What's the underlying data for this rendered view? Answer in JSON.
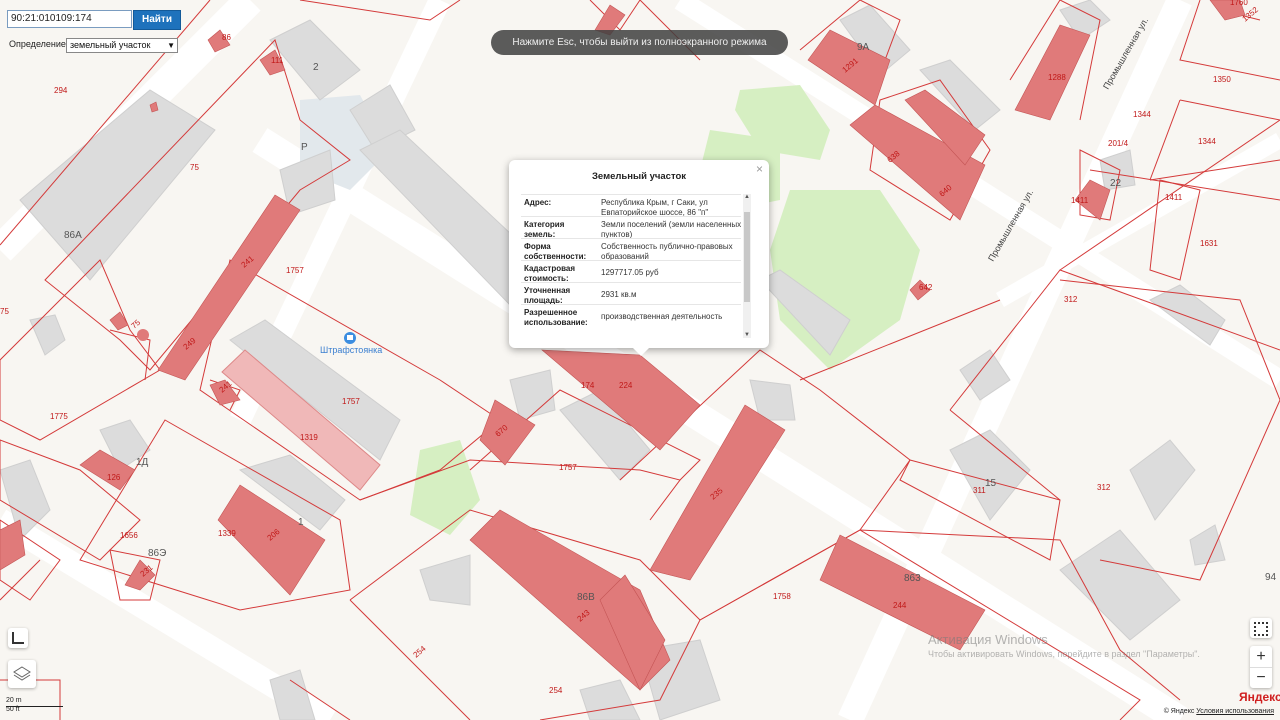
{
  "search": {
    "value": "90:21:010109:174",
    "button_label": "Найти"
  },
  "definition": {
    "label": "Определение:",
    "selected": "земельный участок"
  },
  "fullscreen_notice": "Нажмите Esc, чтобы выйти из полноэкранного режима",
  "popup": {
    "title": "Земельный участок",
    "rows": [
      {
        "key": "Адрес:",
        "value": "Республика Крым, г Саки, ул Евпаторийское шоссе, 86 \"п\""
      },
      {
        "key": "Категория земель:",
        "value": "Земли поселений (земли населенных пунктов)"
      },
      {
        "key": "Форма собственности:",
        "value": "Собственность публично-правовых образований"
      },
      {
        "key": "Кадастровая стоимость:",
        "value": "1297717.05 руб"
      },
      {
        "key": "Уточненная площадь:",
        "value": "2931 кв.м"
      },
      {
        "key": "Разрешенное использование:",
        "value": "производственная деятельность"
      }
    ]
  },
  "map": {
    "poi_parking": "Штрафстоянка",
    "streets": [
      "Промышленная ул.",
      "Промышленная ул."
    ],
    "parcel_labels": [
      "294",
      "75",
      "86",
      "1757",
      "241",
      "249",
      "241",
      "1757",
      "1319",
      "1775",
      "126",
      "1656",
      "231",
      "1339",
      "206",
      "670",
      "174",
      "224",
      "1757",
      "235",
      "1758",
      "863",
      "244",
      "243",
      "254",
      "254",
      "312",
      "311",
      "312",
      "1631",
      "1411",
      "1411",
      "1350",
      "1344",
      "1344",
      "201/4",
      "1288",
      "1291",
      "638",
      "640",
      "1352",
      "1760",
      "642",
      "75",
      "75",
      "111"
    ],
    "building_labels": [
      "2",
      "86А",
      "9А",
      "22",
      "15",
      "1Д",
      "86Э",
      "1",
      "86В",
      "94",
      "Р"
    ]
  },
  "controls": {
    "layers_icon": "layers-icon",
    "ruler_icon": "ruler-icon",
    "fullscreen_icon": "fullscreen-icon",
    "zoom_in": "+",
    "zoom_out": "−"
  },
  "scale": {
    "metric": "20 m",
    "imperial": "50 ft"
  },
  "watermark": {
    "title": "Активация Windows",
    "text": "Чтобы активировать Windows, перейдите в раздел \"Параметры\"."
  },
  "attribution": {
    "prefix": "© Яндекс",
    "terms": "Условия использования",
    "logo": "Яндекс"
  },
  "colors": {
    "parcel_border": "#d43a3a",
    "building_fill": "#e07a7a",
    "park": "#d6efc2"
  }
}
